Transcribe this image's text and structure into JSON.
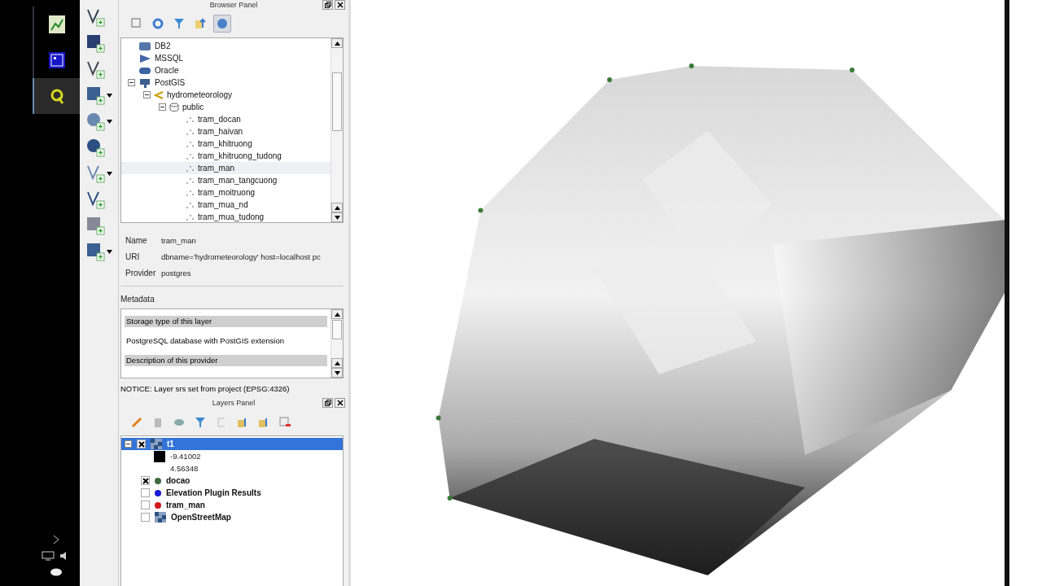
{
  "taskbar": {
    "apps": [
      {
        "kind": "editor",
        "selected": false
      },
      {
        "kind": "window",
        "selected": false
      },
      {
        "kind": "qgis",
        "selected": true
      }
    ]
  },
  "browser_panel": {
    "title": "Browser Panel",
    "tree": [
      {
        "label": "DB2",
        "kind": "db2"
      },
      {
        "label": "MSSQL",
        "kind": "mssql"
      },
      {
        "label": "Oracle",
        "kind": "oracle"
      },
      {
        "label": "PostGIS",
        "kind": "postgis",
        "expanded": true,
        "children": [
          {
            "label": "hydrometeorology",
            "kind": "conn",
            "expanded": true,
            "children": [
              {
                "label": "public",
                "kind": "schema",
                "expanded": true,
                "children": [
                  {
                    "label": "tram_docan",
                    "kind": "points",
                    "selected": false
                  },
                  {
                    "label": "tram_haivan",
                    "kind": "points",
                    "selected": false
                  },
                  {
                    "label": "tram_khitruong",
                    "kind": "points",
                    "selected": false
                  },
                  {
                    "label": "tram_khitruong_tudong",
                    "kind": "points",
                    "selected": false
                  },
                  {
                    "label": "tram_man",
                    "kind": "points",
                    "selected": true
                  },
                  {
                    "label": "tram_man_tangcuong",
                    "kind": "points",
                    "selected": false
                  },
                  {
                    "label": "tram_moitruong",
                    "kind": "points",
                    "selected": false
                  },
                  {
                    "label": "tram_mua_nd",
                    "kind": "points",
                    "selected": false
                  },
                  {
                    "label": "tram_mua_tudong",
                    "kind": "points",
                    "selected": false
                  }
                ]
              }
            ]
          }
        ]
      }
    ]
  },
  "info": [
    {
      "label": "Name",
      "value": "tram_man"
    },
    {
      "label": "URI",
      "value": "dbname='hydrometeorology' host=localhost pc"
    },
    {
      "label": "Provider",
      "value": "postgres"
    }
  ],
  "metadata": {
    "title": "Metadata",
    "rows": [
      {
        "kind": "header",
        "text": "Storage type of this layer"
      },
      {
        "kind": "text",
        "text": "PostgreSQL database with PostGIS extension"
      },
      {
        "kind": "header",
        "text": "Description of this provider"
      }
    ]
  },
  "notice": "NOTICE: Layer srs set from project (EPSG:4326)",
  "layers_panel": {
    "title": "Layers Panel",
    "layers": [
      {
        "name": "t1",
        "kind": "raster",
        "checked": true,
        "expanded": true,
        "selected": true,
        "legend": [
          "-9.41002",
          "4.56348"
        ]
      },
      {
        "name": "docao",
        "kind": "point",
        "color": "#3f6b3f",
        "checked": true,
        "selected": false
      },
      {
        "name": "Elevation Plugin Results",
        "kind": "point",
        "color": "#1a1ad6",
        "checked": false,
        "selected": false
      },
      {
        "name": "tram_man",
        "kind": "point",
        "color": "#d11a1a",
        "checked": false,
        "selected": false
      },
      {
        "name": "OpenStreetMap",
        "kind": "raster",
        "checked": false,
        "selected": false
      }
    ]
  }
}
